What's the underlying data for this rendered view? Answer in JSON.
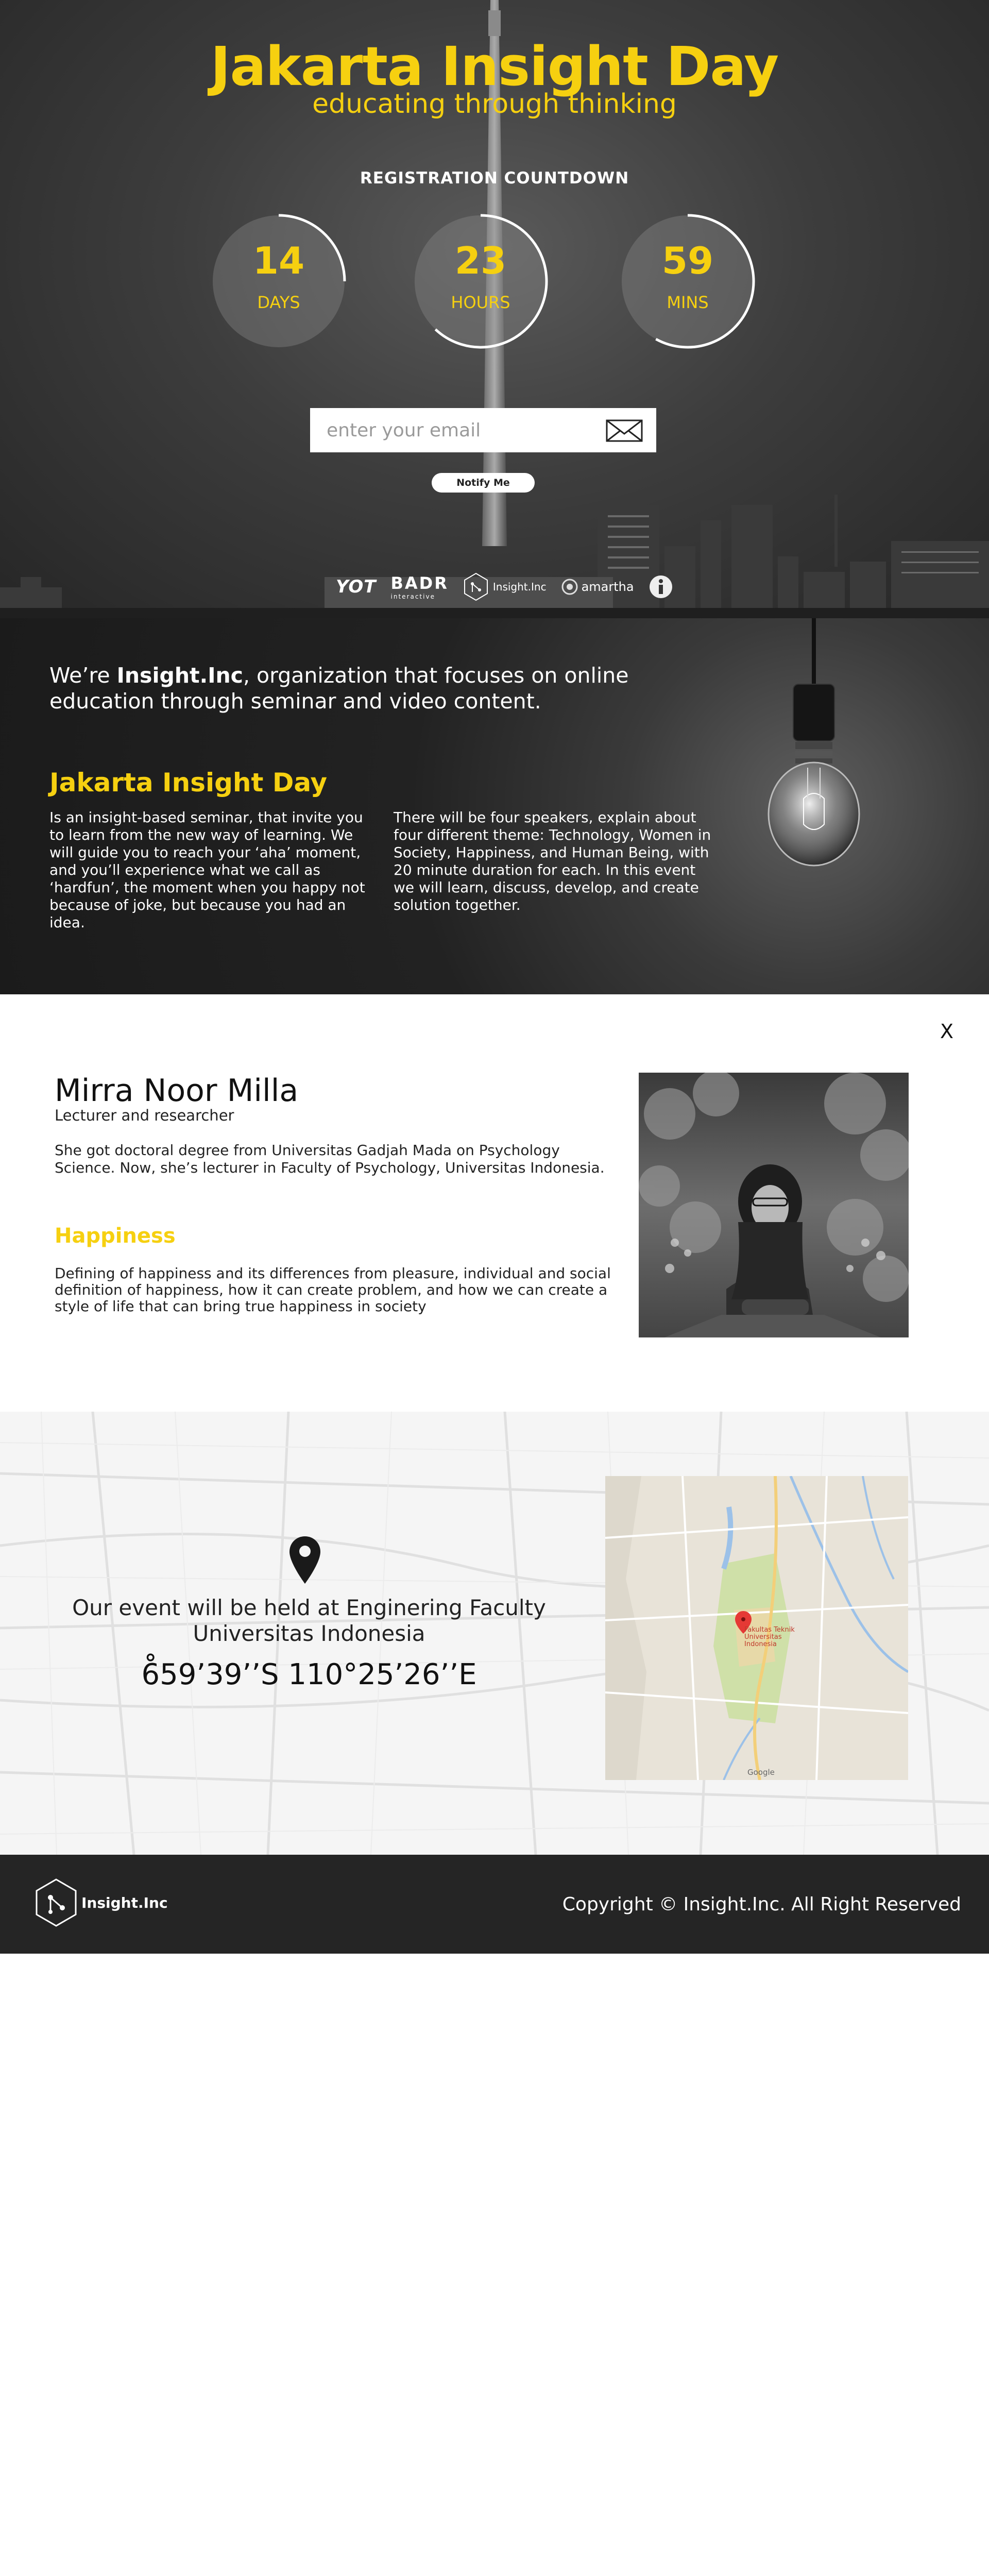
{
  "hero": {
    "title": "Jakarta Insight Day",
    "subtitle": "educating through thinking",
    "countdown_label": "REGISTRATION COUNTDOWN",
    "countdown": [
      {
        "value": "14",
        "unit": "DAYS",
        "progress": 0.25
      },
      {
        "value": "23",
        "unit": "HOURS",
        "progress": 0.62
      },
      {
        "value": "59",
        "unit": "MINS",
        "progress": 0.58
      }
    ],
    "email_placeholder": "enter your email",
    "notify_label": "Notify Me",
    "sponsors": {
      "yot": "YOT",
      "badr": "BADR",
      "badr_sub": "interactive",
      "insight": "Insight.Inc",
      "amartha": "amartha"
    }
  },
  "about": {
    "intro_prefix": "We’re ",
    "intro_brand": "Insight.Inc",
    "intro_suffix": ", organization that focuses on online education through seminar and video content.",
    "heading": "Jakarta Insight Day",
    "col1": "Is an insight-based seminar, that invite you to learn from the new way of learning. We will guide you to reach your ‘aha’ moment, and you’ll experience what we call as ‘hardfun’, the moment when you happy not because of joke, but because you had an idea.",
    "col2": "There will be four speakers, explain about four different theme: Technology, Women in Society, Happiness, and Human Being, with 20 minute duration for each. In this event we will learn, discuss, develop, and create solution together."
  },
  "speaker": {
    "close_label": "X",
    "name": "Mirra Noor Milla",
    "role": "Lecturer and researcher",
    "bio": "She got doctoral degree from Universitas Gadjah Mada on Psychology Science. Now, she’s lecturer in Faculty of Psychology, Universitas Indonesia.",
    "topic_title": "Happiness",
    "topic_desc": "Defining of happiness and its differences from pleasure, individual and social definition of happiness, how it can create problem, and how we can create a style of life that can bring true happiness in society"
  },
  "venue": {
    "text": "Our event will be held at Enginering Faculty Universitas Indonesia",
    "coordinates": "6̊59’39’’S 110°25’26’’E",
    "map_place": "Fakultas Teknik Universitas Indonesia",
    "map_brand": "Google"
  },
  "footer": {
    "logo_text": "Insight.Inc",
    "copyright": "Copyright © Insight.Inc. All Right Reserved"
  },
  "colors": {
    "accent": "#f6d010",
    "hero_dark": "#2b2b2b",
    "footer_bg": "#252525"
  },
  "icons": [
    "mail-icon",
    "map-pin-icon",
    "insight-logo-icon",
    "amartha-logo-icon",
    "info-icon",
    "light-bulb-icon"
  ]
}
